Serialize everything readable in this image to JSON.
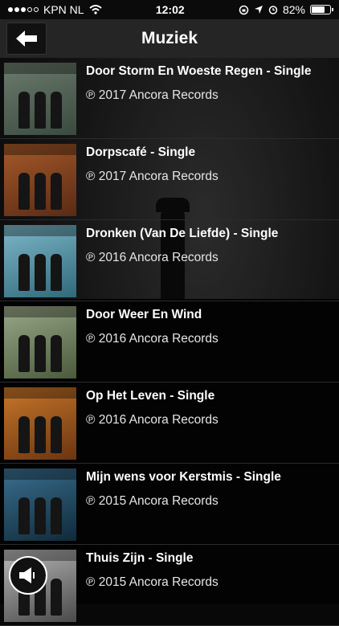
{
  "status": {
    "carrier": "KPN NL",
    "time": "12:02",
    "battery": "82%",
    "battery_fraction": 0.82
  },
  "header": {
    "title": "Muziek"
  },
  "albums": [
    {
      "title": "Door Storm En Woeste Regen - Single",
      "subtitle": "℗ 2017 Ancora Records",
      "colors": [
        "#6b7c6e",
        "#3a4a3f"
      ]
    },
    {
      "title": "Dorpscafé - Single",
      "subtitle": "℗ 2017 Ancora Records",
      "colors": [
        "#a65a2a",
        "#5a2a14"
      ]
    },
    {
      "title": "Dronken (Van De Liefde) - Single",
      "subtitle": "℗ 2016 Ancora Records",
      "colors": [
        "#7fb7c9",
        "#2f6a7a"
      ]
    },
    {
      "title": "Door Weer En Wind",
      "subtitle": "℗ 2016 Ancora Records",
      "colors": [
        "#9aa88a",
        "#4a5a3a"
      ]
    },
    {
      "title": "Op Het Leven - Single",
      "subtitle": "℗ 2016 Ancora Records",
      "colors": [
        "#c8772a",
        "#6a3510"
      ]
    },
    {
      "title": "Mijn wens voor Kerstmis - Single",
      "subtitle": "℗ 2015 Ancora Records",
      "colors": [
        "#3b6f8f",
        "#0f2a3a"
      ]
    },
    {
      "title": "Thuis Zijn - Single",
      "subtitle": "℗ 2015 Ancora Records",
      "colors": [
        "#b8b8b8",
        "#4a4a4a"
      ]
    }
  ]
}
